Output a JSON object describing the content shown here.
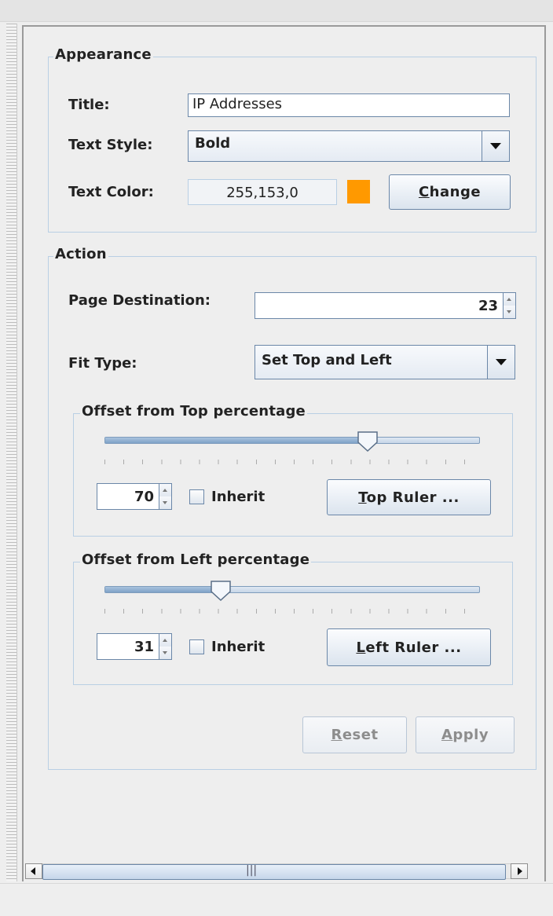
{
  "appearance": {
    "legend": "Appearance",
    "title_label": "Title:",
    "title_value": "IP Addresses",
    "text_style_label": "Text Style:",
    "text_style_value": "Bold",
    "text_color_label": "Text Color:",
    "text_color_value": "255,153,0",
    "text_color_swatch": "#ff9900",
    "change_button": {
      "mnemonic": "C",
      "rest": "hange"
    }
  },
  "action": {
    "legend": "Action",
    "page_destination_label": "Page Destination:",
    "page_destination_value": "23",
    "fit_type_label": "Fit Type:",
    "fit_type_value": "Set Top and Left",
    "offset_top": {
      "legend": "Offset from Top percentage",
      "value": "70",
      "slider_percent": 70,
      "inherit_label": "Inherit",
      "inherit_checked": false,
      "ruler_button": {
        "mnemonic": "T",
        "rest": "op Ruler ..."
      }
    },
    "offset_left": {
      "legend": "Offset from Left percentage",
      "value": "31",
      "slider_percent": 31,
      "inherit_label": "Inherit",
      "inherit_checked": false,
      "ruler_button": {
        "mnemonic": "L",
        "rest": "eft Ruler ..."
      }
    },
    "reset_button": {
      "mnemonic": "R",
      "rest": "eset",
      "enabled": false
    },
    "apply_button": {
      "mnemonic": "A",
      "rest": "pply",
      "enabled": false
    }
  },
  "scrollbar": {
    "left_icon": "arrow-left-icon",
    "right_icon": "arrow-right-icon",
    "grip_glyph": "|||"
  }
}
